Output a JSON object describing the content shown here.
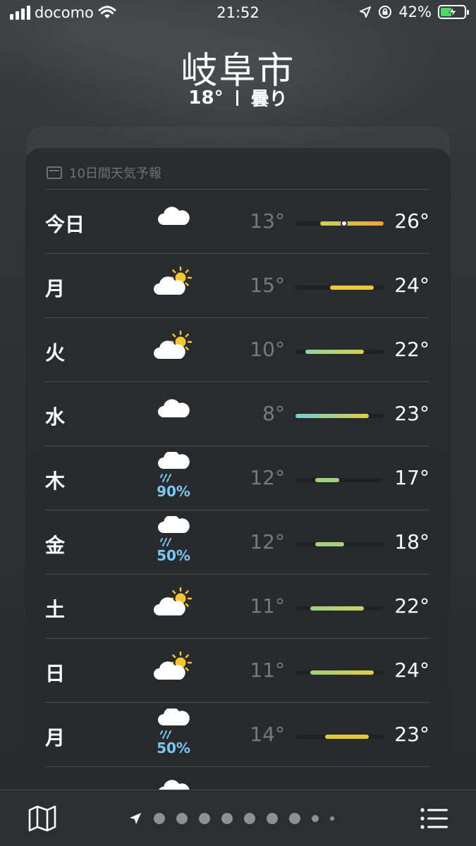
{
  "status_bar": {
    "carrier": "docomo",
    "time": "21:52",
    "battery": "42%",
    "battery_level": 0.42
  },
  "header": {
    "city": "岐阜市",
    "temp": "18°",
    "condition": "曇り"
  },
  "forecast": {
    "title": "10日間天気予報",
    "range_min": 8,
    "range_max": 26,
    "days": [
      {
        "day": "今日",
        "icon": "cloud-icon",
        "pop": "",
        "low": "13°",
        "high": "26°",
        "low_v": 13,
        "high_v": 26,
        "current_v": 18,
        "c1": "#c7d35a",
        "c2": "#f0a23a"
      },
      {
        "day": "月",
        "icon": "partly-sunny-icon",
        "pop": "",
        "low": "15°",
        "high": "24°",
        "low_v": 15,
        "high_v": 24,
        "c1": "#e8c93a",
        "c2": "#e8c93a"
      },
      {
        "day": "火",
        "icon": "partly-sunny-icon",
        "pop": "",
        "low": "10°",
        "high": "22°",
        "low_v": 10,
        "high_v": 22,
        "c1": "#8fd1a6",
        "c2": "#d7d24a"
      },
      {
        "day": "水",
        "icon": "cloud-icon",
        "pop": "",
        "low": "8°",
        "high": "23°",
        "low_v": 8,
        "high_v": 23,
        "c1": "#6fd0da",
        "c2": "#e0cf3e"
      },
      {
        "day": "木",
        "icon": "rain-cloud-icon",
        "pop": "90%",
        "low": "12°",
        "high": "17°",
        "low_v": 12,
        "high_v": 17,
        "c1": "#9ed27e",
        "c2": "#9ed27e"
      },
      {
        "day": "金",
        "icon": "rain-cloud-icon",
        "pop": "50%",
        "low": "12°",
        "high": "18°",
        "low_v": 12,
        "high_v": 18,
        "c1": "#a1d27a",
        "c2": "#aed374"
      },
      {
        "day": "土",
        "icon": "partly-sunny-icon",
        "pop": "",
        "low": "11°",
        "high": "22°",
        "low_v": 11,
        "high_v": 22,
        "c1": "#9cd183",
        "c2": "#cbd35a"
      },
      {
        "day": "日",
        "icon": "partly-sunny-icon",
        "pop": "",
        "low": "11°",
        "high": "24°",
        "low_v": 11,
        "high_v": 24,
        "c1": "#9cd183",
        "c2": "#e4cc40"
      },
      {
        "day": "月",
        "icon": "rain-cloud-icon",
        "pop": "50%",
        "low": "14°",
        "high": "23°",
        "low_v": 14,
        "high_v": 23,
        "c1": "#e2c93c",
        "c2": "#e2c93c"
      }
    ]
  },
  "bottom_bar": {
    "map_icon": "map-icon",
    "location_icon": "location-arrow-icon",
    "list_icon": "list-icon",
    "page_count": 9
  }
}
